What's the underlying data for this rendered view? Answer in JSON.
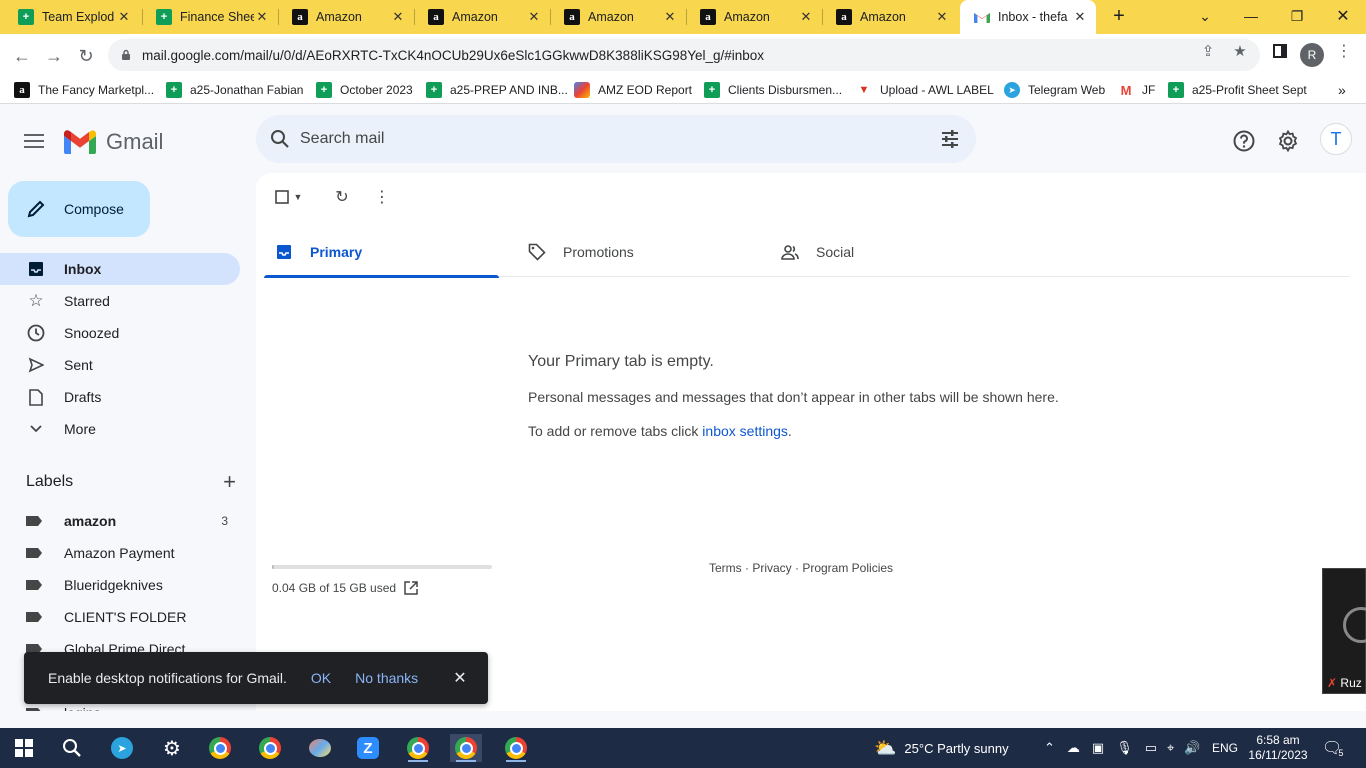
{
  "browser": {
    "tabs": [
      {
        "title": "Team Explod",
        "icon": "sheets-icon"
      },
      {
        "title": "Finance Shee",
        "icon": "sheets-icon"
      },
      {
        "title": "Amazon",
        "icon": "amazon-icon"
      },
      {
        "title": "Amazon",
        "icon": "amazon-icon"
      },
      {
        "title": "Amazon",
        "icon": "amazon-icon"
      },
      {
        "title": "Amazon",
        "icon": "amazon-icon"
      },
      {
        "title": "Amazon",
        "icon": "amazon-icon"
      },
      {
        "title": "Inbox - thefa",
        "icon": "gmail-icon",
        "active": true
      }
    ],
    "url": "mail.google.com/mail/u/0/d/AEoRXRTC-TxCK4nOCUb29Ux6eSlc1GGkwwD8K388liKSG98Yel_g/#inbox",
    "profile_initial": "R",
    "bookmarks": [
      {
        "label": "The Fancy Marketpl...",
        "icon": "amazon-icon"
      },
      {
        "label": "a25-Jonathan Fabian",
        "icon": "sheets-icon"
      },
      {
        "label": "October 2023",
        "icon": "sheets-icon"
      },
      {
        "label": "a25-PREP AND INB...",
        "icon": "sheets-icon"
      },
      {
        "label": "AMZ EOD Report",
        "icon": "colorful-icon"
      },
      {
        "label": "Clients Disbursmen...",
        "icon": "sheets-icon"
      },
      {
        "label": "Upload - AWL LABEL",
        "icon": "red-triangle-icon"
      },
      {
        "label": "Telegram Web",
        "icon": "telegram-icon"
      },
      {
        "label": "JF",
        "icon": "gmail-icon"
      },
      {
        "label": "a25-Profit Sheet Sept",
        "icon": "sheets-icon"
      }
    ],
    "bookmarks_more": "»"
  },
  "gmail": {
    "logo_text": "Gmail",
    "search_placeholder": "Search mail",
    "avatar_initial": "T",
    "compose_label": "Compose",
    "nav": [
      {
        "label": "Inbox",
        "icon": "inbox-icon",
        "active": true
      },
      {
        "label": "Starred",
        "icon": "star-icon"
      },
      {
        "label": "Snoozed",
        "icon": "clock-icon"
      },
      {
        "label": "Sent",
        "icon": "send-icon"
      },
      {
        "label": "Drafts",
        "icon": "draft-icon"
      },
      {
        "label": "More",
        "icon": "chevron-down-icon"
      }
    ],
    "labels_title": "Labels",
    "labels": [
      {
        "name": "amazon",
        "count": "3",
        "bold": true
      },
      {
        "name": "Amazon Payment"
      },
      {
        "name": "Blueridgeknives"
      },
      {
        "name": "CLIENT'S FOLDER"
      },
      {
        "name": "Global Prime Direct"
      },
      {
        "name": "logins"
      }
    ],
    "tabs": [
      {
        "label": "Primary",
        "icon": "inbox-tab-icon",
        "active": true
      },
      {
        "label": "Promotions",
        "icon": "tag-icon"
      },
      {
        "label": "Social",
        "icon": "people-icon"
      }
    ],
    "empty_title": "Your Primary tab is empty.",
    "empty_desc": "Personal messages and messages that don’t appear in other tabs will be shown here.",
    "empty_settings_prefix": "To add or remove tabs click ",
    "empty_settings_link": "inbox settings",
    "empty_settings_suffix": ".",
    "storage_text": "0.04 GB of 15 GB used",
    "storage_fraction": 0.0027,
    "footer": "Terms · Privacy · Program Policies",
    "toast": {
      "message": "Enable desktop notifications for Gmail.",
      "ok": "OK",
      "no_thanks": "No thanks"
    },
    "pip_name": "Ruz"
  },
  "taskbar": {
    "weather": "25°C  Partly sunny",
    "lang": "ENG",
    "time": "6:58 am",
    "date": "16/11/2023",
    "notifications": "5"
  }
}
